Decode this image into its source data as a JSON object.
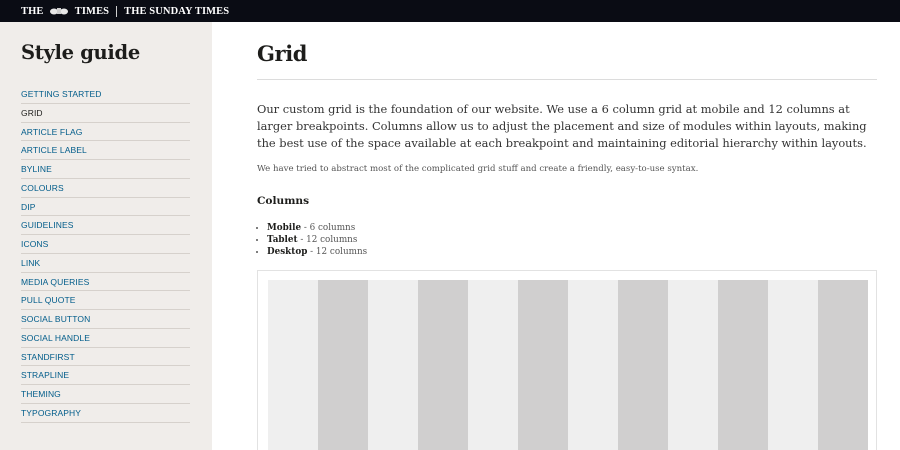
{
  "header": {
    "brand_times": "THE TIMES",
    "brand_sunday": "THE SUNDAY TIMES"
  },
  "sidebar": {
    "title": "Style guide",
    "items": [
      {
        "label": "GETTING STARTED",
        "active": false
      },
      {
        "label": "GRID",
        "active": true
      },
      {
        "label": "ARTICLE FLAG",
        "active": false
      },
      {
        "label": "ARTICLE LABEL",
        "active": false
      },
      {
        "label": "BYLINE",
        "active": false
      },
      {
        "label": "COLOURS",
        "active": false
      },
      {
        "label": "DIP",
        "active": false
      },
      {
        "label": "GUIDELINES",
        "active": false
      },
      {
        "label": "ICONS",
        "active": false
      },
      {
        "label": "LINK",
        "active": false
      },
      {
        "label": "MEDIA QUERIES",
        "active": false
      },
      {
        "label": "PULL QUOTE",
        "active": false
      },
      {
        "label": "SOCIAL BUTTON",
        "active": false
      },
      {
        "label": "SOCIAL HANDLE",
        "active": false
      },
      {
        "label": "STANDFIRST",
        "active": false
      },
      {
        "label": "STRAPLINE",
        "active": false
      },
      {
        "label": "THEMING",
        "active": false
      },
      {
        "label": "TYPOGRAPHY",
        "active": false
      }
    ]
  },
  "main": {
    "title": "Grid",
    "intro": "Our custom grid is the foundation of our website. We use a 6 column grid at mobile and 12 columns at larger breakpoints. Columns allow us to adjust the placement and size of modules within layouts, making the best use of the space available at each breakpoint and maintaining editorial hierarchy within layouts.",
    "note": "We have tried to abstract most of the complicated grid stuff and create a friendly, easy-to-use syntax.",
    "columns_heading": "Columns",
    "columns": [
      {
        "name": "Mobile",
        "detail": " - 6 columns"
      },
      {
        "name": "Tablet",
        "detail": " - 12 columns"
      },
      {
        "name": "Desktop",
        "detail": " - 12 columns"
      }
    ],
    "grid_demo": {
      "column_count": 12,
      "colors": {
        "light": "#efefef",
        "dark": "#d0cfcf"
      }
    }
  },
  "colors": {
    "header_bg": "#0a0c14",
    "sidebar_bg": "#f0edea",
    "link": "#005c8a"
  }
}
